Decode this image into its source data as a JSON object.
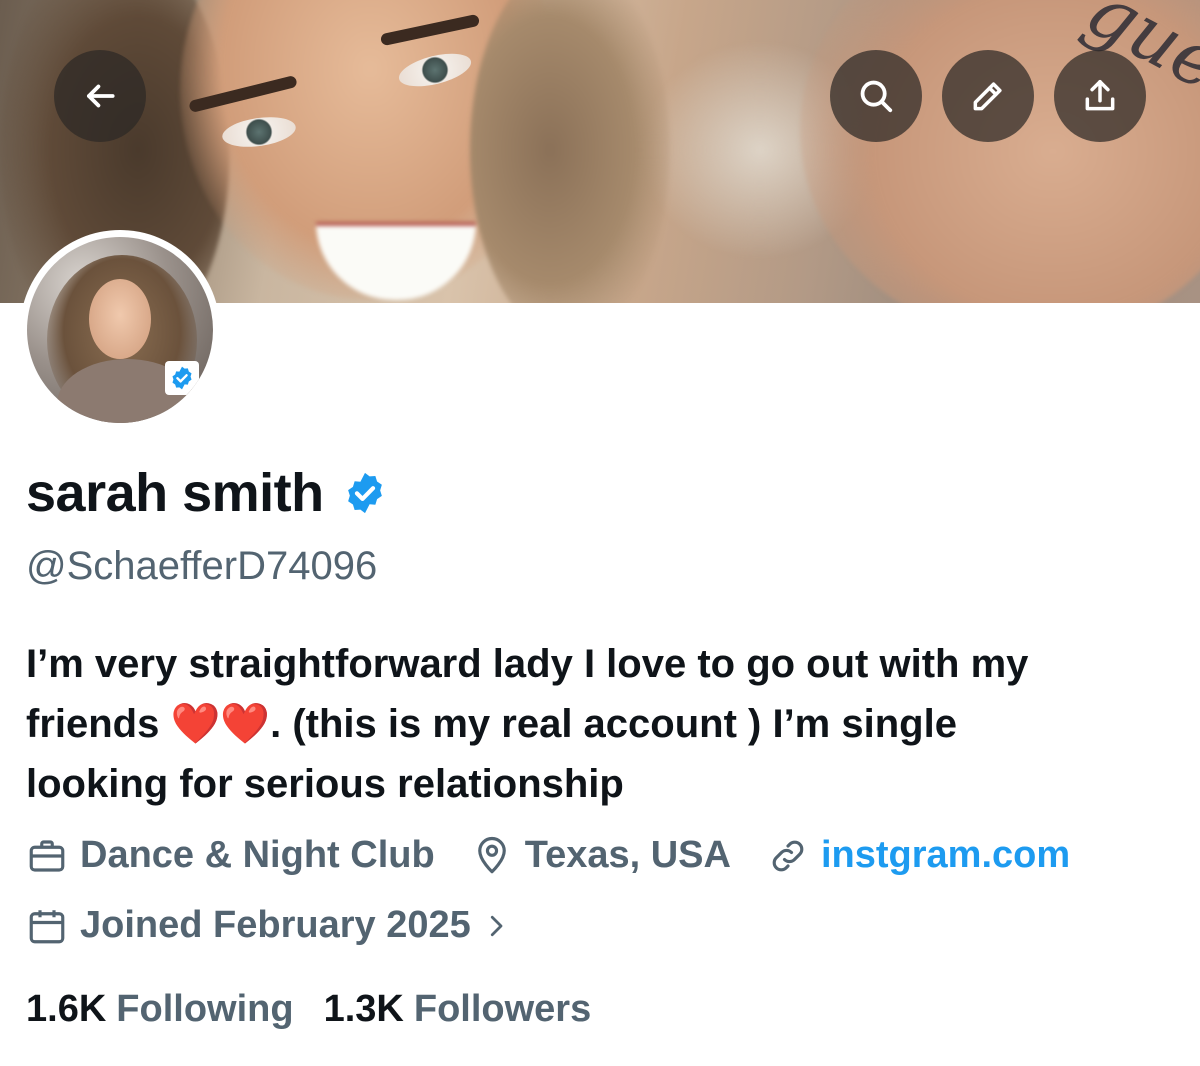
{
  "header": {
    "back_icon": "arrow-left-icon",
    "actions": [
      "search-icon",
      "edit-pencil-icon",
      "share-upload-icon"
    ]
  },
  "profile": {
    "name": "sarah smith",
    "handle": "@SchaefferD74096",
    "verified": true,
    "bio_line1": "I’m very straightforward lady I love to go out with my",
    "bio_line2_start": "friends ",
    "bio_hearts": "❤️❤️",
    "bio_line2_end": ". (this is my real account ) I’m single",
    "bio_line3": "looking for serious relationship",
    "occupation": "Dance & Night Club",
    "location": "Texas, USA",
    "website": "instgram.com",
    "joined": "Joined February 2025"
  },
  "stats": {
    "following_count": "1.6K",
    "following_label": "Following",
    "followers_count": "1.3K",
    "followers_label": "Followers"
  },
  "colors": {
    "accent": "#1d9bf0",
    "secondary_text": "#536471",
    "primary_text": "#0f1419"
  }
}
